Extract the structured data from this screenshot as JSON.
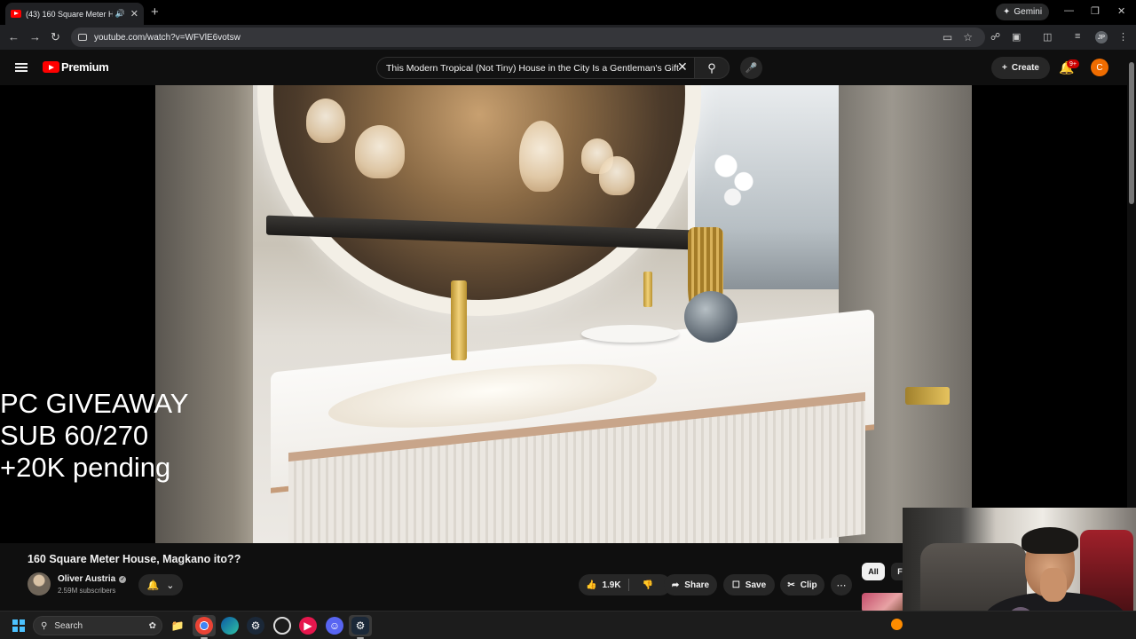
{
  "browser": {
    "tab_title": "(43) 160 Square Meter Hou",
    "url": "youtube.com/watch?v=WFVlE6votsw",
    "gemini_label": "Gemini",
    "profile_initials": "JP"
  },
  "youtube": {
    "logo_label": "Premium",
    "search_value": "This Modern Tropical (Not Tiny) House in the City Is a Gentleman's Gift",
    "create_label": "Create",
    "notification_badge": "9+",
    "avatar_initial": "C"
  },
  "overlay": {
    "line1": "PC GIVEAWAY",
    "line2": "SUB 60/270",
    "line3": "+20K pending"
  },
  "video": {
    "title": "160 Square Meter House, Magkano ito??",
    "channel_name": "Oliver Austria",
    "subscribers": "2.59M subscribers",
    "like_count": "1.9K",
    "share_label": "Share",
    "save_label": "Save",
    "clip_label": "Clip"
  },
  "sidebar_chips": {
    "all_label": "All",
    "second_label": "F"
  },
  "taskbar": {
    "search_label": "Search"
  },
  "icons": {
    "accent": "#ff0000",
    "notification_badge_color": "#cc0000",
    "avatar_color": "#ef6c00"
  }
}
